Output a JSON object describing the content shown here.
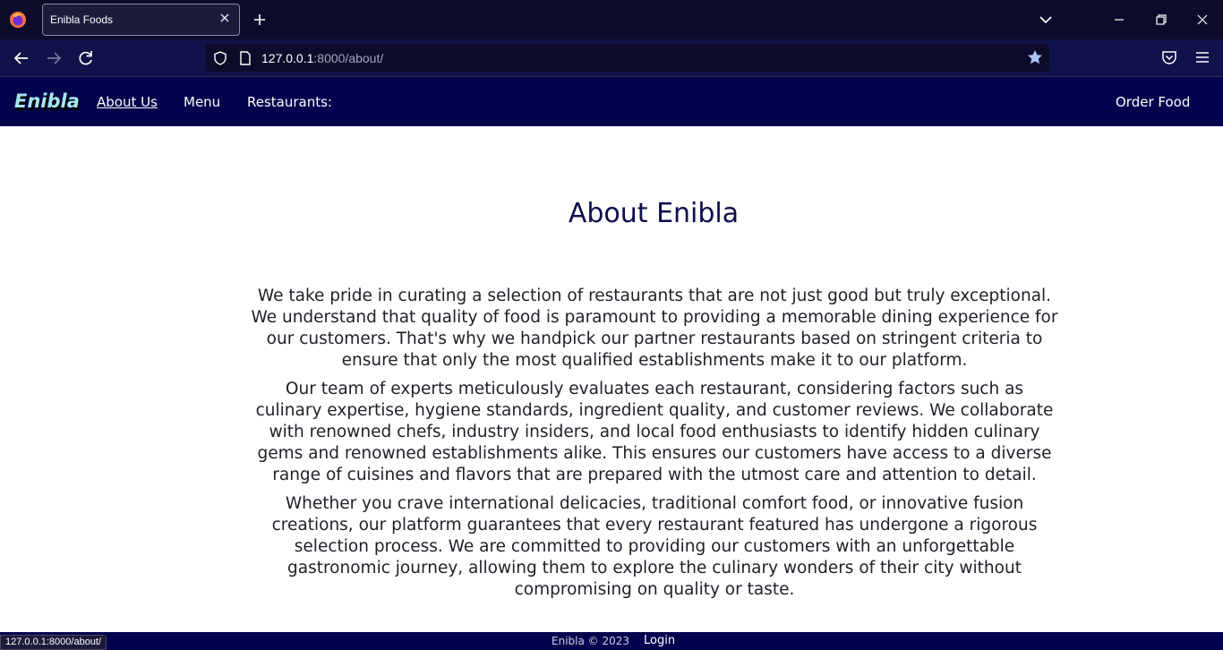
{
  "browser": {
    "tab_title": "Enibla Foods",
    "url_host": "127.0.0.1",
    "url_rest": ":8000/about/",
    "status_url": "127.0.0.1:8000/about/"
  },
  "header": {
    "brand": "Enibla",
    "nav": [
      {
        "label": "About Us"
      },
      {
        "label": "Menu"
      },
      {
        "label": "Restaurants:"
      }
    ],
    "order_label": "Order Food"
  },
  "main": {
    "title": "About Enibla",
    "paragraphs": [
      "We take pride in curating a selection of restaurants that are not just good but truly exceptional. We understand that quality of food is paramount to providing a memorable dining experience for our customers. That's why we handpick our partner restaurants based on stringent criteria to ensure that only the most qualified establishments make it to our platform.",
      "Our team of experts meticulously evaluates each restaurant, considering factors such as culinary expertise, hygiene standards, ingredient quality, and customer reviews. We collaborate with renowned chefs, industry insiders, and local food enthusiasts to identify hidden culinary gems and renowned establishments alike. This ensures our customers have access to a diverse range of cuisines and flavors that are prepared with the utmost care and attention to detail.",
      "Whether you crave international delicacies, traditional comfort food, or innovative fusion creations, our platform guarantees that every restaurant featured has undergone a rigorous selection process. We are committed to providing our customers with an unforgettable gastronomic journey, allowing them to explore the culinary wonders of their city without compromising on quality or taste."
    ]
  },
  "footer": {
    "copyright": "Enibla © 2023",
    "login": "Login"
  },
  "colors": {
    "header_bg": "#03034e",
    "brand": "#a6e6f0",
    "title": "#0d0d4c",
    "chrome_bg": "#0c0c2a"
  }
}
